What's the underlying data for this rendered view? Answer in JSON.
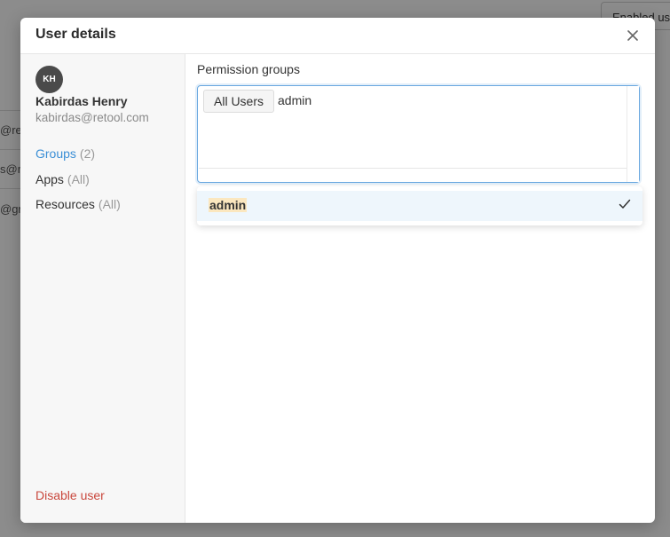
{
  "background": {
    "top_button_label": "Enabled us",
    "row_fragments": [
      "@retc",
      "s@r",
      "@gr"
    ]
  },
  "modal": {
    "title": "User details",
    "close_icon": "close-icon"
  },
  "user": {
    "initials": "KH",
    "name": "Kabirdas Henry",
    "email": "kabirdas@retool.com"
  },
  "nav": [
    {
      "label": "Groups",
      "count": "(2)",
      "active": true
    },
    {
      "label": "Apps",
      "count": "(All)",
      "active": false
    },
    {
      "label": "Resources",
      "count": "(All)",
      "active": false
    }
  ],
  "disable_label": "Disable user",
  "permissions": {
    "label": "Permission groups",
    "chips": [
      "All Users"
    ],
    "input_value": "admin",
    "options": [
      {
        "label": "admin",
        "selected": true,
        "icon": "check-icon"
      }
    ]
  },
  "colors": {
    "accent": "#3b8fd6",
    "danger": "#c9473c",
    "highlight": "#fbe7bf"
  }
}
